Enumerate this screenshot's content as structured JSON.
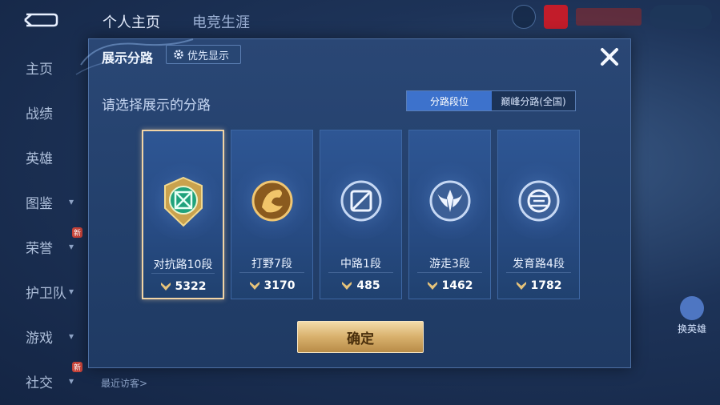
{
  "header": {
    "tabs": [
      {
        "label": "个人主页",
        "active": true
      },
      {
        "label": "电竞生涯",
        "active": false
      }
    ]
  },
  "sidebar": {
    "items": [
      {
        "label": "主页",
        "chevron": false,
        "badge": ""
      },
      {
        "label": "战绩",
        "chevron": false,
        "badge": ""
      },
      {
        "label": "英雄",
        "chevron": false,
        "badge": ""
      },
      {
        "label": "图鉴",
        "chevron": true,
        "badge": ""
      },
      {
        "label": "荣誉",
        "chevron": true,
        "badge": "新"
      },
      {
        "label": "护卫队",
        "chevron": true,
        "badge": ""
      },
      {
        "label": "游戏",
        "chevron": true,
        "badge": ""
      },
      {
        "label": "社交",
        "chevron": true,
        "badge": "新"
      }
    ]
  },
  "bottom": {
    "recent_visitors": "最近访客>"
  },
  "right_panel": {
    "change_hero": "换英雄"
  },
  "modal": {
    "title": "展示分路",
    "priority_label": "优先显示",
    "subtitle": "请选择展示的分路",
    "segments": [
      {
        "label": "分路段位",
        "active": true
      },
      {
        "label": "巅峰分路(全国)",
        "active": false
      }
    ],
    "lanes": [
      {
        "rank": "对抗路10段",
        "points": "5322",
        "selected": true,
        "emblem": "clash-lane-emblem-icon",
        "color": "#2bb58c"
      },
      {
        "rank": "打野7段",
        "points": "3170",
        "selected": false,
        "emblem": "jungle-dragon-emblem-icon",
        "color": "#d89a3a"
      },
      {
        "rank": "中路1段",
        "points": "485",
        "selected": false,
        "emblem": "mid-lane-emblem-icon",
        "color": "#6a8fc7"
      },
      {
        "rank": "游走3段",
        "points": "1462",
        "selected": false,
        "emblem": "roam-wings-emblem-icon",
        "color": "#7aa0d8"
      },
      {
        "rank": "发育路4段",
        "points": "1782",
        "selected": false,
        "emblem": "farm-lane-emblem-icon",
        "color": "#8fb0e0"
      }
    ],
    "confirm_label": "确定"
  },
  "colors": {
    "accent_blue": "#3d72cc",
    "gold_button": "#d8b06c",
    "selected_border": "#f1d4a5"
  }
}
